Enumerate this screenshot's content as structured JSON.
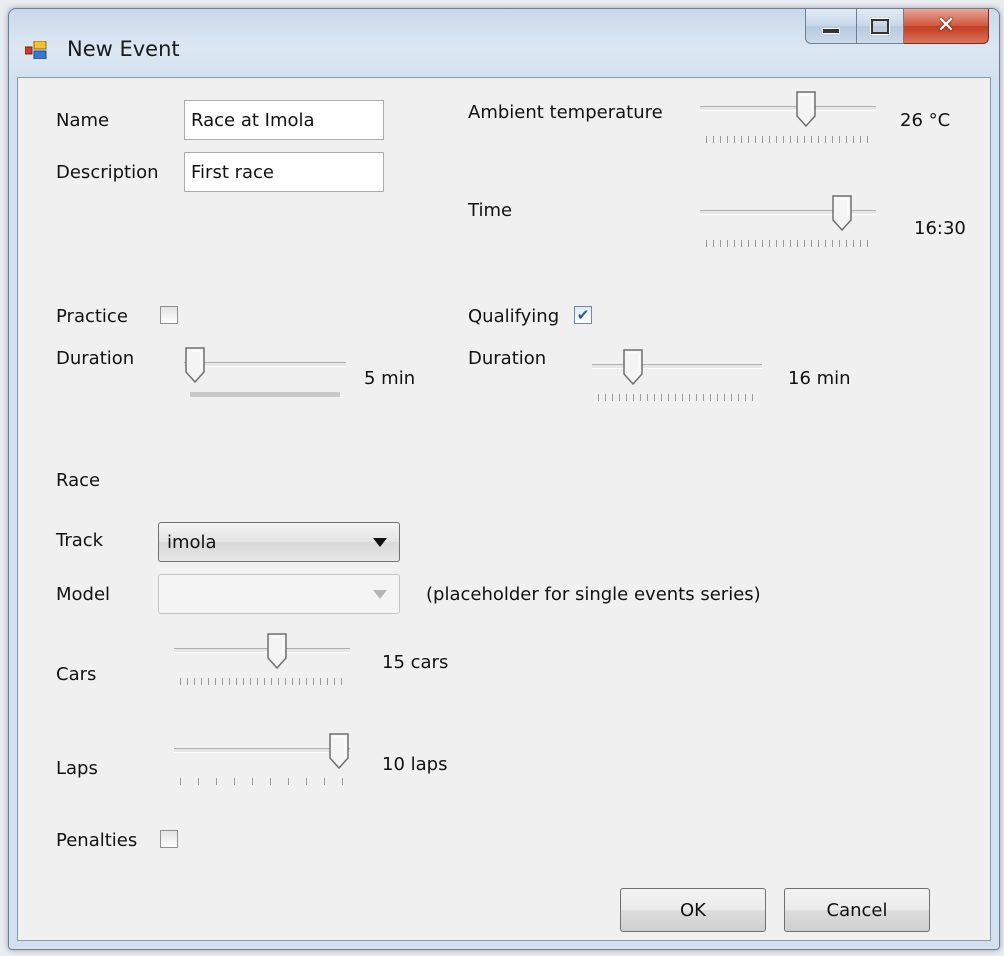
{
  "window": {
    "title": "New Event",
    "close_glyph": "✕"
  },
  "form": {
    "name_label": "Name",
    "name_value": "Race at Imola",
    "description_label": "Description",
    "description_value": "First race",
    "ambient_label": "Ambient temperature",
    "ambient_value": "26 °C",
    "ambient_position": 0.62,
    "time_label": "Time",
    "time_value": "16:30",
    "time_position": 0.85,
    "practice_label": "Practice",
    "practice_checked": false,
    "practice_duration_label": "Duration",
    "practice_duration_value": "5 min",
    "practice_duration_position": 0.0,
    "qualifying_label": "Qualifying",
    "qualifying_checked": true,
    "qualifying_duration_label": "Duration",
    "qualifying_duration_value": "16 min",
    "qualifying_duration_position": 0.2,
    "race_heading": "Race",
    "track_label": "Track",
    "track_value": "imola",
    "model_label": "Model",
    "model_value": "",
    "model_note": "(placeholder for single events series)",
    "cars_label": "Cars",
    "cars_value": "15 cars",
    "cars_position": 0.6,
    "laps_label": "Laps",
    "laps_value": "10 laps",
    "laps_position": 1.0,
    "penalties_label": "Penalties",
    "penalties_checked": false,
    "check_glyph": "✔"
  },
  "buttons": {
    "ok_label": "OK",
    "cancel_label": "Cancel"
  }
}
